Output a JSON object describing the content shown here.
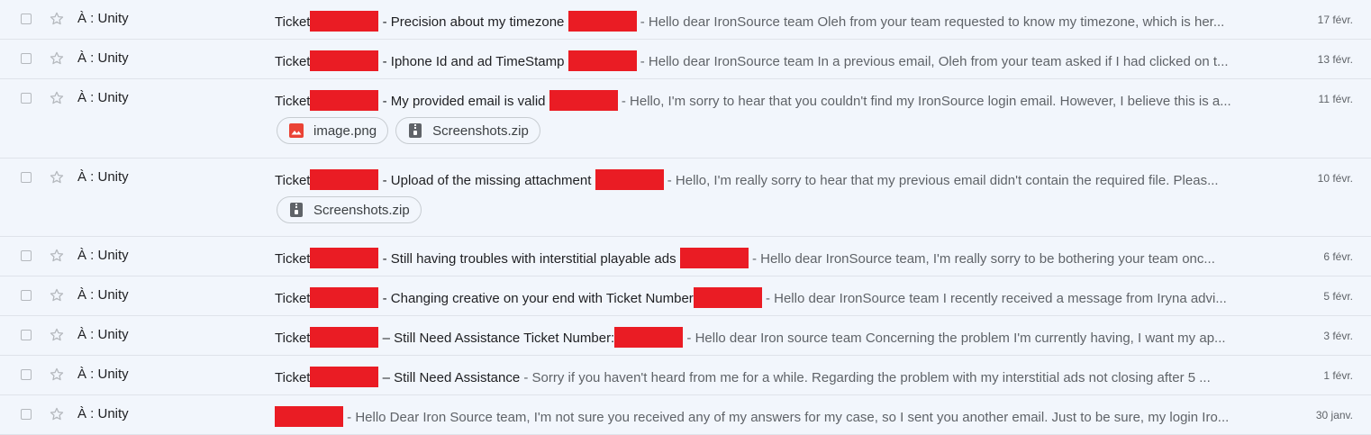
{
  "emails": [
    {
      "sender": "À : Unity",
      "subject_prefix": "Ticket",
      "subject": " - Precision about my timezone ",
      "snippet": " - Hello dear IronSource team Oleh from your team requested to know my timezone, which is her...",
      "date": "17 févr.",
      "attachments": []
    },
    {
      "sender": "À : Unity",
      "subject_prefix": "Ticket",
      "subject": " - Iphone Id and ad TimeStamp ",
      "snippet": " - Hello dear IronSource team In a previous email, Oleh from your team asked if I had clicked on t...",
      "date": "13 févr.",
      "attachments": []
    },
    {
      "sender": "À : Unity",
      "subject_prefix": "Ticket",
      "subject": " - My provided email is valid ",
      "snippet": " - Hello, I'm sorry to hear that you couldn't find my IronSource login email. However, I believe this is a...",
      "date": "11 févr.",
      "attachments": [
        {
          "name": "image.png",
          "icon": "image-file-icon",
          "color": "#ea4335"
        },
        {
          "name": "Screenshots.zip",
          "icon": "zip-file-icon",
          "color": "#5f6368"
        }
      ]
    },
    {
      "sender": "À : Unity",
      "subject_prefix": "Ticket",
      "subject": " - Upload of the missing attachment ",
      "snippet": " - Hello, I'm really sorry to hear that my previous email didn't contain the required file. Pleas...",
      "date": "10 févr.",
      "attachments": [
        {
          "name": "Screenshots.zip",
          "icon": "zip-file-icon",
          "color": "#5f6368"
        }
      ]
    },
    {
      "sender": "À : Unity",
      "subject_prefix": "Ticket",
      "subject": " - Still having troubles with interstitial playable ads ",
      "snippet": " - Hello dear IronSource team, I'm really sorry to be bothering your team onc...",
      "date": "6 févr.",
      "attachments": []
    },
    {
      "sender": "À : Unity",
      "subject_prefix": "Ticket",
      "subject": " - Changing creative on your end with Ticket Number",
      "snippet": " - Hello dear IronSource team I recently received a message from Iryna advi...",
      "date": "5 févr.",
      "attachments": []
    },
    {
      "sender": "À : Unity",
      "subject_prefix": "Ticket",
      "subject": " – Still Need Assistance Ticket Number:",
      "snippet": " - Hello dear Iron source team Concerning the problem I'm currently having, I want my ap...",
      "date": "3 févr.",
      "attachments": []
    },
    {
      "sender": "À : Unity",
      "subject_prefix": "Ticket",
      "subject": " – Still Need Assistance",
      "snippet": " - Sorry if you haven't heard from me for a while. Regarding the problem with my interstitial ads not closing after 5 ...",
      "date": "1 févr.",
      "attachments": [],
      "no_second_redaction": true
    },
    {
      "sender": "À : Unity",
      "subject_prefix": "",
      "subject": "",
      "snippet": " - Hello Dear Iron Source team, I'm not sure you received any of my answers for my case, so I sent you another email. Just to be sure, my login Iro...",
      "date": "30 janv.",
      "attachments": [],
      "no_second_redaction": true,
      "redaction_only_subject": true
    }
  ],
  "colors": {
    "redaction": "#ea1c24",
    "background": "#f2f6fc"
  }
}
